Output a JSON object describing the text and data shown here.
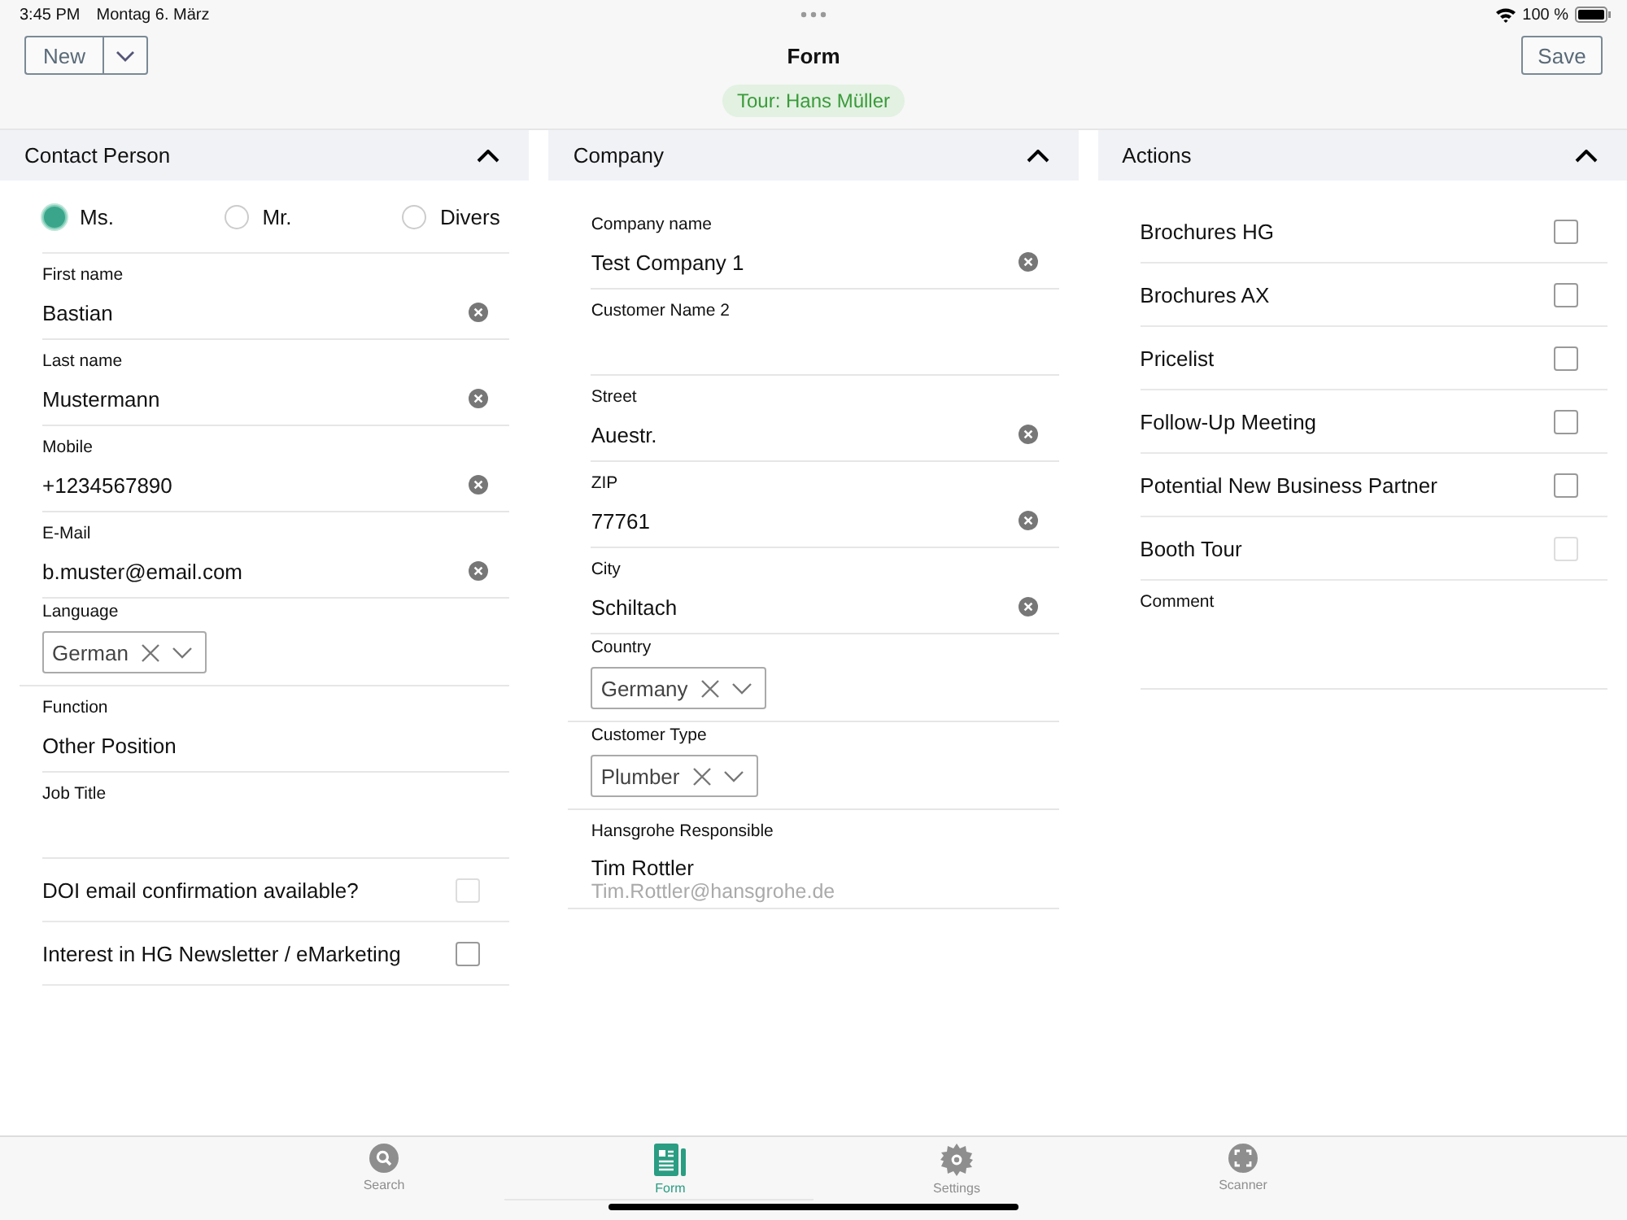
{
  "status_bar": {
    "time": "3:45 PM",
    "date": "Montag 6. März",
    "battery": "100 %"
  },
  "toolbar": {
    "new_button": "New",
    "title": "Form",
    "save_button": "Save",
    "tour": "Tour: Hans Müller"
  },
  "sections": [
    {
      "title": "Contact Person",
      "expanded": true,
      "radios": [
        {
          "label": "Ms.",
          "selected": true
        },
        {
          "label": "Mr.",
          "selected": false
        },
        {
          "label": "Divers",
          "selected": false
        }
      ],
      "items": [
        {
          "kind": "text",
          "label": "First name",
          "value": "Bastian",
          "clearable": true
        },
        {
          "kind": "text",
          "label": "Last name",
          "value": "Mustermann",
          "clearable": true
        },
        {
          "kind": "text",
          "label": "Mobile",
          "value": "+1234567890",
          "clearable": true
        },
        {
          "kind": "text",
          "label": "E-Mail",
          "value": "b.muster@email.com",
          "clearable": true
        },
        {
          "kind": "select",
          "label": "Language",
          "value": "German"
        },
        {
          "kind": "text",
          "label": "Function",
          "value": "Other Position",
          "clearable": false
        },
        {
          "kind": "text",
          "label": "Job Title",
          "clearable": false
        },
        {
          "kind": "checkbox",
          "label": "DOI email confirmation available?",
          "checked": false,
          "disabled": true
        },
        {
          "kind": "checkbox",
          "label": "Interest in HG Newsletter / eMarketing",
          "checked": false,
          "disabled": false
        }
      ]
    },
    {
      "title": "Company",
      "expanded": true,
      "items": [
        {
          "kind": "text",
          "label": "Company name",
          "value": "Test Company 1",
          "clearable": true
        },
        {
          "kind": "text",
          "label": "Customer Name 2",
          "clearable": false
        },
        {
          "kind": "text",
          "label": "Street",
          "value": "Auestr.",
          "clearable": true
        },
        {
          "kind": "text",
          "label": "ZIP",
          "value": "77761",
          "clearable": true
        },
        {
          "kind": "text",
          "label": "City",
          "value": "Schiltach",
          "clearable": true
        },
        {
          "kind": "select",
          "label": "Country",
          "value": "Germany"
        },
        {
          "kind": "select",
          "label": "Customer Type",
          "value": "Plumber"
        },
        {
          "kind": "person",
          "label": "Hansgrohe Responsible",
          "value": "Tim Rottler",
          "sub": "Tim.Rottler@hansgrohe.de"
        }
      ]
    },
    {
      "title": "Actions",
      "expanded": true,
      "items": [
        {
          "kind": "checkbox",
          "label": "Brochures HG",
          "checked": false,
          "disabled": false
        },
        {
          "kind": "checkbox",
          "label": "Brochures AX",
          "checked": false,
          "disabled": false
        },
        {
          "kind": "checkbox",
          "label": "Pricelist",
          "checked": false,
          "disabled": false
        },
        {
          "kind": "checkbox",
          "label": "Follow-Up Meeting",
          "checked": false,
          "disabled": false
        },
        {
          "kind": "checkbox",
          "label": "Potential New Business Partner",
          "checked": false,
          "disabled": false
        },
        {
          "kind": "checkbox",
          "label": "Booth Tour",
          "checked": false,
          "disabled": true
        },
        {
          "kind": "text",
          "label": "Comment",
          "clearable": false
        }
      ]
    }
  ],
  "tab_bar": [
    {
      "label": "Search",
      "selected": false
    },
    {
      "label": "Form",
      "selected": true
    },
    {
      "label": "Settings",
      "selected": false
    },
    {
      "label": "Scanner",
      "selected": false
    }
  ]
}
